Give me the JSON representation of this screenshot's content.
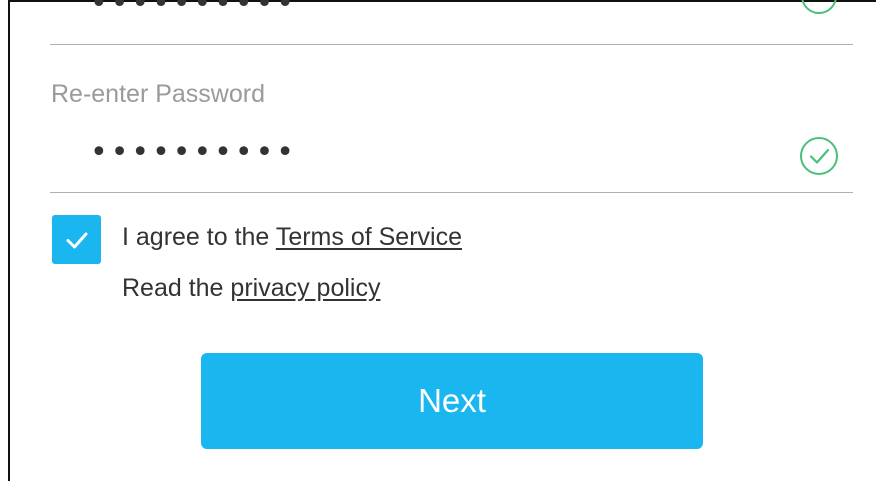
{
  "previous_field": {
    "value": "••••••••••",
    "status_icon": "check-circle-icon"
  },
  "reenter_password": {
    "label": "Re-enter Password",
    "value": "••••••••••",
    "status_icon": "check-circle-icon"
  },
  "terms": {
    "checked": true,
    "prefix": "I agree to the ",
    "link_text": "Terms of Service"
  },
  "privacy": {
    "prefix": "Read the ",
    "link_text": "privacy policy"
  },
  "next_button": {
    "label": "Next"
  },
  "colors": {
    "accent": "#1ab6ef",
    "valid": "#4ac07a",
    "text": "#333333",
    "label": "#9a9a9a"
  }
}
